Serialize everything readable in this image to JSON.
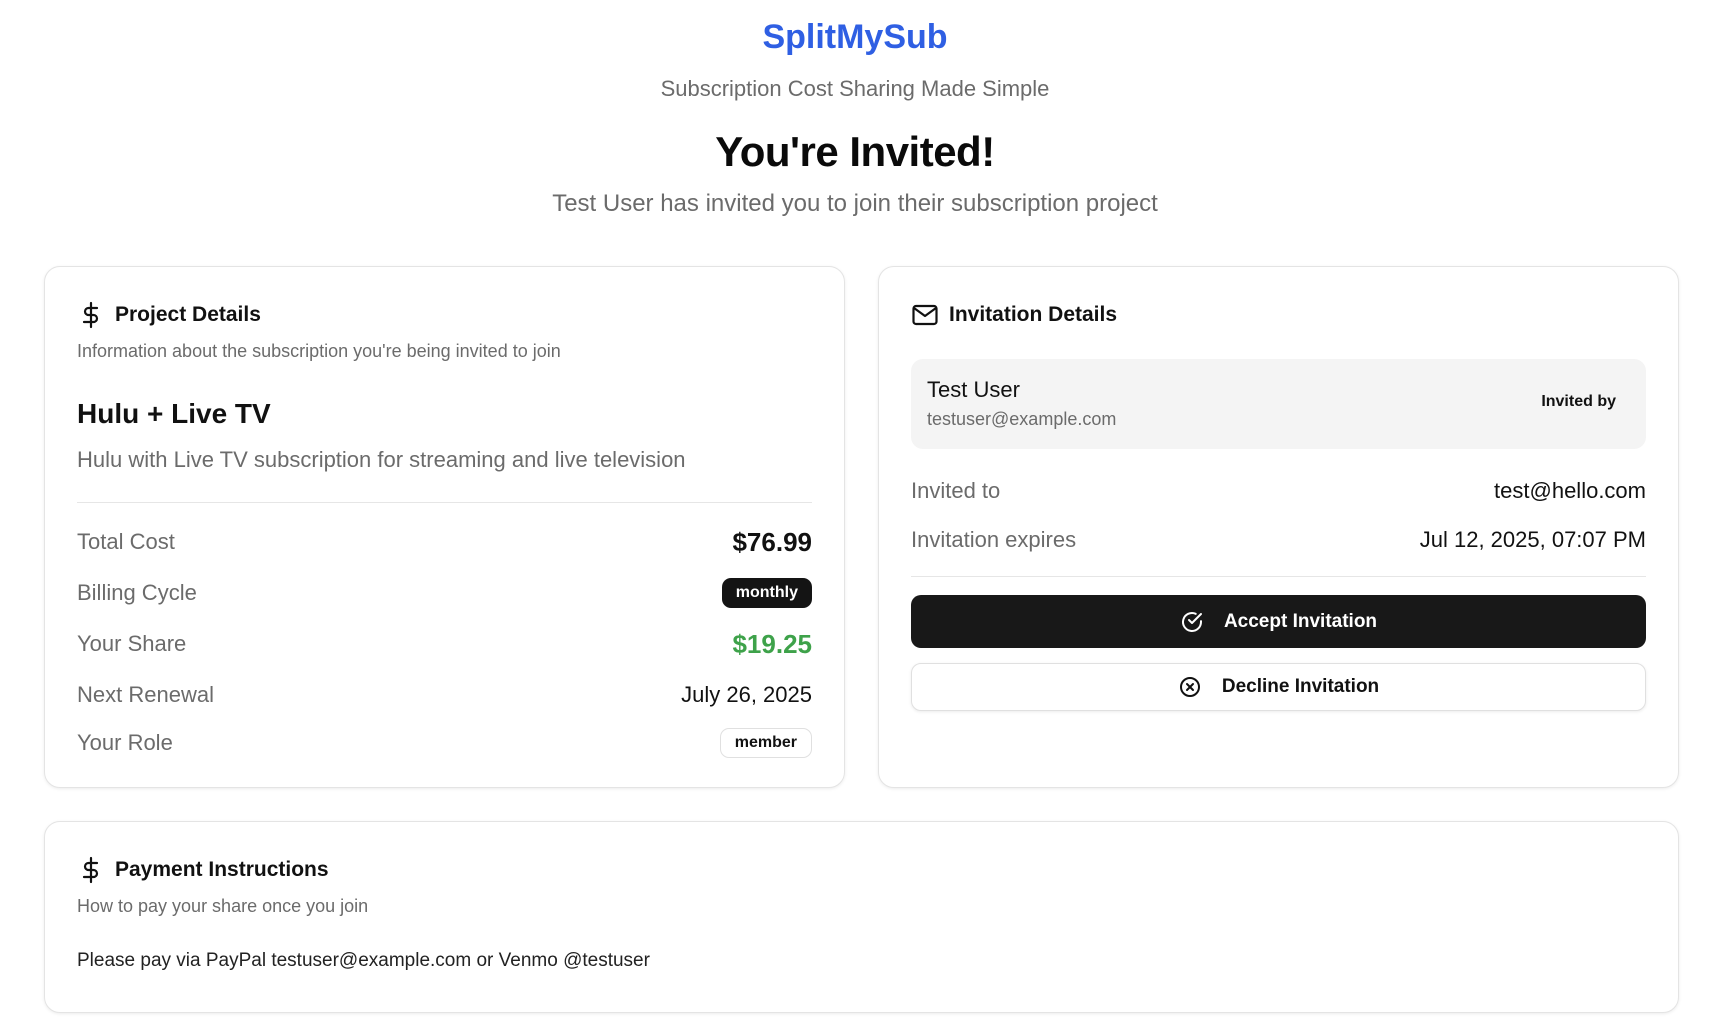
{
  "header": {
    "brand": "SplitMySub",
    "tagline": "Subscription Cost Sharing Made Simple",
    "title": "You're Invited!",
    "subtitle": "Test User has invited you to join their subscription project"
  },
  "project_card": {
    "icon": "dollar-icon",
    "title": "Project Details",
    "description": "Information about the subscription you're being invited to join",
    "project_name": "Hulu + Live TV",
    "project_description": "Hulu with Live TV subscription for streaming and live television",
    "rows": {
      "total_cost": {
        "label": "Total Cost",
        "value": "$76.99"
      },
      "billing_cycle": {
        "label": "Billing Cycle",
        "value": "monthly"
      },
      "your_share": {
        "label": "Your Share",
        "value": "$19.25"
      },
      "next_renewal": {
        "label": "Next Renewal",
        "value": "July 26, 2025"
      },
      "your_role": {
        "label": "Your Role",
        "value": "member"
      }
    }
  },
  "invitation_card": {
    "icon": "mail-icon",
    "title": "Invitation Details",
    "inviter": {
      "name": "Test User",
      "email": "testuser@example.com",
      "tag": "Invited by"
    },
    "rows": {
      "invited_to": {
        "label": "Invited to",
        "value": "test@hello.com"
      },
      "expires": {
        "label": "Invitation expires",
        "value": "Jul 12, 2025, 07:07 PM"
      }
    },
    "accept_label": "Accept Invitation",
    "decline_label": "Decline Invitation"
  },
  "payment_card": {
    "icon": "dollar-icon",
    "title": "Payment Instructions",
    "description": "How to pay your share once you join",
    "text": "Please pay via PayPal testuser@example.com or Venmo @testuser"
  },
  "colors": {
    "brand": "#2f5fe3",
    "share_green": "#3ea24a",
    "accept_bg": "#181818"
  }
}
